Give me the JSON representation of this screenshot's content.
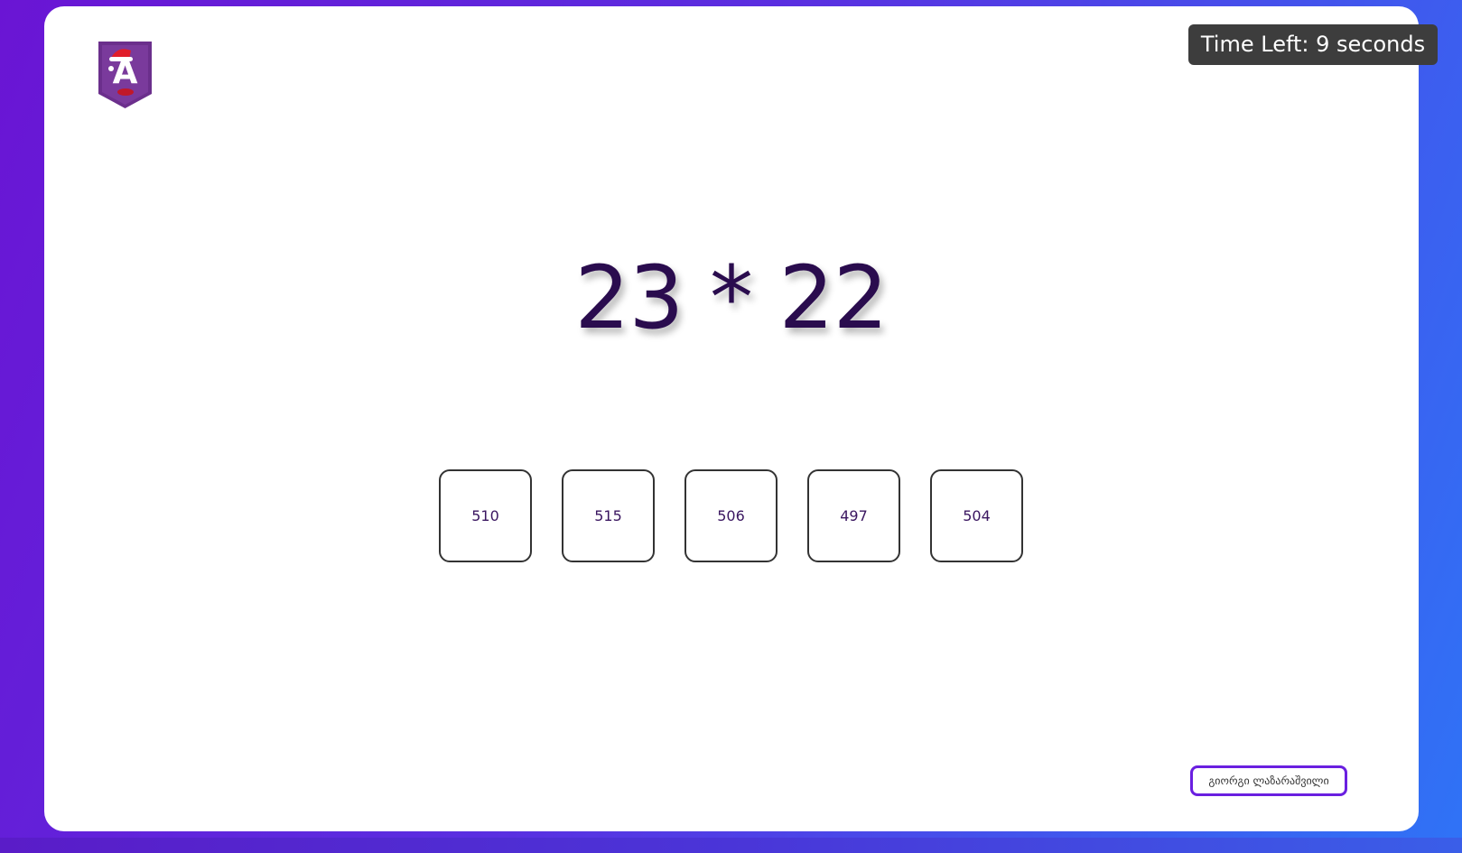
{
  "timer": {
    "text": "Time Left: 9 seconds"
  },
  "logo": {
    "letter": "A",
    "icon": "academy-logo-santa-hat-icon"
  },
  "question": {
    "expression": "23 * 22"
  },
  "options": [
    {
      "label": "510"
    },
    {
      "label": "515"
    },
    {
      "label": "506"
    },
    {
      "label": "497"
    },
    {
      "label": "504"
    }
  ],
  "author": {
    "name": "გიორგი ლაზარაშვილი"
  },
  "colors": {
    "background_start": "#6a15d4",
    "background_end": "#2f73f6",
    "card": "#ffffff",
    "equation_text": "#2a0c4e",
    "timer_bg": "#3d3d3d",
    "author_border": "#6a1fe0",
    "logo_purple": "#6b2f8c"
  }
}
